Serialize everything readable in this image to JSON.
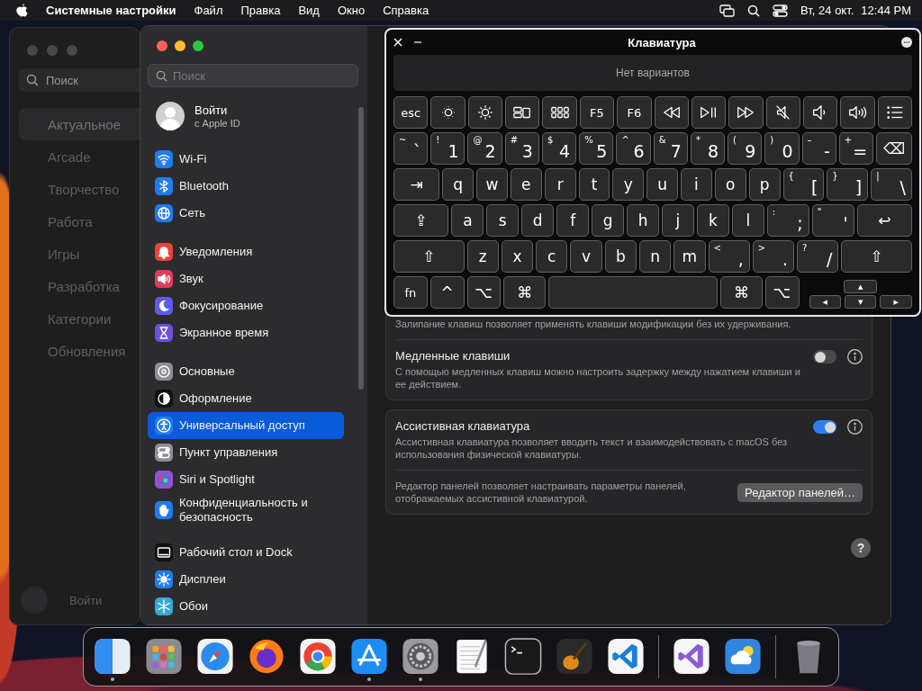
{
  "menu_bar": {
    "app": "Системные настройки",
    "menus": [
      "Файл",
      "Правка",
      "Вид",
      "Окно",
      "Справка"
    ],
    "date": "Вт, 24 окт.",
    "time": "12:44 PM"
  },
  "background_window": {
    "search": {
      "placeholder": "Поиск"
    },
    "items": [
      {
        "label": "Актуальное",
        "selected": true
      },
      {
        "label": "Arcade",
        "selected": false
      },
      {
        "label": "Творчество",
        "selected": false
      },
      {
        "label": "Работа",
        "selected": false
      },
      {
        "label": "Игры",
        "selected": false
      },
      {
        "label": "Разработка",
        "selected": false
      },
      {
        "label": "Категории",
        "selected": false
      },
      {
        "label": "Обновления",
        "selected": false
      }
    ],
    "account": "Войти"
  },
  "settings": {
    "search": {
      "placeholder": "Поиск"
    },
    "account": {
      "title": "Войти",
      "subtitle": "с Apple ID"
    },
    "groups": [
      [
        {
          "label": "Wi-Fi",
          "color": "#1f7cf0",
          "selected": false
        },
        {
          "label": "Bluetooth",
          "color": "#1f7cf0",
          "selected": false
        },
        {
          "label": "Сеть",
          "color": "#1f7cf0",
          "selected": false
        }
      ],
      [
        {
          "label": "Уведомления",
          "color": "#e8443a",
          "selected": false
        },
        {
          "label": "Звук",
          "color": "#e23a5a",
          "selected": false
        },
        {
          "label": "Фокусирование",
          "color": "#5e5ce6",
          "selected": false
        },
        {
          "label": "Экранное время",
          "color": "#6e4fd6",
          "selected": false
        }
      ],
      [
        {
          "label": "Основные",
          "color": "#8e8e93",
          "selected": false
        },
        {
          "label": "Оформление",
          "color": "#111111",
          "selected": false
        },
        {
          "label": "Универсальный доступ",
          "color": "#1f7cf0",
          "selected": true
        },
        {
          "label": "Пункт управления",
          "color": "#8e8e93",
          "selected": false
        },
        {
          "label": "Siri и Spotlight",
          "color": "#9a4fd0",
          "selected": false
        },
        {
          "label": "Конфиденциальность и безопасность",
          "color": "#1f7cf0",
          "selected": false
        }
      ],
      [
        {
          "label": "Рабочий стол и Dock",
          "color": "#111111",
          "selected": false
        },
        {
          "label": "Дисплеи",
          "color": "#1f7cf0",
          "selected": false
        },
        {
          "label": "Обои",
          "color": "#36a8d8",
          "selected": false
        }
      ]
    ],
    "cards": [
      {
        "rows": [
          {
            "kind": "text",
            "description": "Залипание клавиш позволяет применять клавиши модификации без их удерживания."
          },
          {
            "kind": "toggle",
            "title": "Медленные клавиши",
            "description": "С помощью медленных клавиш можно настроить задержку между нажатием клавиши и ее действием.",
            "on": false
          }
        ]
      },
      {
        "rows": [
          {
            "kind": "toggle",
            "title": "Ассистивная клавиатура",
            "description": "Ассистивная клавиатура позволяет вводить текст и взаимодействовать с macOS без использования физической клавиатуры.",
            "on": true
          },
          {
            "kind": "button",
            "description": "Редактор панелей позволяет настраивать параметры панелей, отображаемых ассистивной клавиатурой.",
            "button": "Редактор панелей…"
          }
        ]
      }
    ],
    "help": "?"
  },
  "keyboard": {
    "title": "Клавиатура",
    "suggestions": "Нет вариантов",
    "rows": [
      {
        "keys": [
          {
            "kind": "text",
            "label": "esc"
          },
          {
            "kind": "icon"
          },
          {
            "kind": "icon"
          },
          {
            "kind": "icon"
          },
          {
            "kind": "icon"
          },
          {
            "kind": "text",
            "label": "F5"
          },
          {
            "kind": "text",
            "label": "F6"
          },
          {
            "kind": "icon"
          },
          {
            "kind": "icon"
          },
          {
            "kind": "icon"
          },
          {
            "kind": "icon"
          },
          {
            "kind": "icon"
          },
          {
            "kind": "icon"
          },
          {
            "kind": "icon"
          }
        ]
      },
      {
        "keys": [
          {
            "kind": "dual",
            "shift": "~",
            "label": "`"
          },
          {
            "kind": "dual",
            "shift": "!",
            "label": "1"
          },
          {
            "kind": "dual",
            "shift": "@",
            "label": "2"
          },
          {
            "kind": "dual",
            "shift": "#",
            "label": "3"
          },
          {
            "kind": "dual",
            "shift": "$",
            "label": "4"
          },
          {
            "kind": "dual",
            "shift": "%",
            "label": "5"
          },
          {
            "kind": "dual",
            "shift": "^",
            "label": "6"
          },
          {
            "kind": "dual",
            "shift": "&",
            "label": "7"
          },
          {
            "kind": "dual",
            "shift": "*",
            "label": "8"
          },
          {
            "kind": "dual",
            "shift": "(",
            "label": "9"
          },
          {
            "kind": "dual",
            "shift": ")",
            "label": "0"
          },
          {
            "kind": "dual",
            "shift": "–",
            "label": "-"
          },
          {
            "kind": "dual",
            "shift": "+",
            "label": "="
          },
          {
            "kind": "text",
            "label": "⌫"
          }
        ]
      },
      {
        "keys": [
          {
            "kind": "text",
            "label": "⇥"
          },
          {
            "kind": "text",
            "label": "q"
          },
          {
            "kind": "text",
            "label": "w"
          },
          {
            "kind": "text",
            "label": "e"
          },
          {
            "kind": "text",
            "label": "r"
          },
          {
            "kind": "text",
            "label": "t"
          },
          {
            "kind": "text",
            "label": "y"
          },
          {
            "kind": "text",
            "label": "u"
          },
          {
            "kind": "text",
            "label": "i"
          },
          {
            "kind": "text",
            "label": "o"
          },
          {
            "kind": "text",
            "label": "p"
          },
          {
            "kind": "dual",
            "shift": "{",
            "label": "["
          },
          {
            "kind": "dual",
            "shift": "}",
            "label": "]"
          },
          {
            "kind": "dual",
            "shift": "|",
            "label": "\\"
          }
        ]
      },
      {
        "keys": [
          {
            "kind": "text",
            "label": "⇪"
          },
          {
            "kind": "text",
            "label": "a"
          },
          {
            "kind": "text",
            "label": "s"
          },
          {
            "kind": "text",
            "label": "d"
          },
          {
            "kind": "text",
            "label": "f"
          },
          {
            "kind": "text",
            "label": "g"
          },
          {
            "kind": "text",
            "label": "h"
          },
          {
            "kind": "text",
            "label": "j"
          },
          {
            "kind": "text",
            "label": "k"
          },
          {
            "kind": "text",
            "label": "l"
          },
          {
            "kind": "dual",
            "shift": ":",
            "label": ";"
          },
          {
            "kind": "dual",
            "shift": "\"",
            "label": "'"
          },
          {
            "kind": "text",
            "label": "↩"
          }
        ]
      },
      {
        "keys": [
          {
            "kind": "text",
            "label": "⇧"
          },
          {
            "kind": "text",
            "label": "z"
          },
          {
            "kind": "text",
            "label": "x"
          },
          {
            "kind": "text",
            "label": "c"
          },
          {
            "kind": "text",
            "label": "v"
          },
          {
            "kind": "text",
            "label": "b"
          },
          {
            "kind": "text",
            "label": "n"
          },
          {
            "kind": "text",
            "label": "m"
          },
          {
            "kind": "dual",
            "shift": "<",
            "label": ","
          },
          {
            "kind": "dual",
            "shift": ">",
            "label": "."
          },
          {
            "kind": "dual",
            "shift": "?",
            "label": "/"
          },
          {
            "kind": "text",
            "label": "⇧"
          }
        ]
      },
      {
        "keys": [
          {
            "kind": "text",
            "label": "fn"
          },
          {
            "kind": "text",
            "label": "^"
          },
          {
            "kind": "text",
            "label": "⌥"
          },
          {
            "kind": "text",
            "label": "⌘"
          },
          {
            "kind": "space"
          },
          {
            "kind": "text",
            "label": "⌘"
          },
          {
            "kind": "text",
            "label": "⌥"
          }
        ]
      }
    ],
    "arrow_keys": [
      "▲",
      "◀",
      "▼",
      "▶"
    ]
  },
  "dock": {
    "sections": [
      [
        {
          "running": true
        },
        {
          "running": false
        },
        {
          "running": false
        },
        {
          "running": false
        },
        {
          "running": false
        },
        {
          "running": true
        },
        {
          "running": true
        },
        {
          "running": false
        },
        {
          "running": false
        },
        {
          "running": false
        },
        {
          "running": false
        }
      ],
      [
        {
          "running": false
        },
        {
          "running": false
        }
      ],
      [
        {
          "running": false
        }
      ]
    ]
  }
}
